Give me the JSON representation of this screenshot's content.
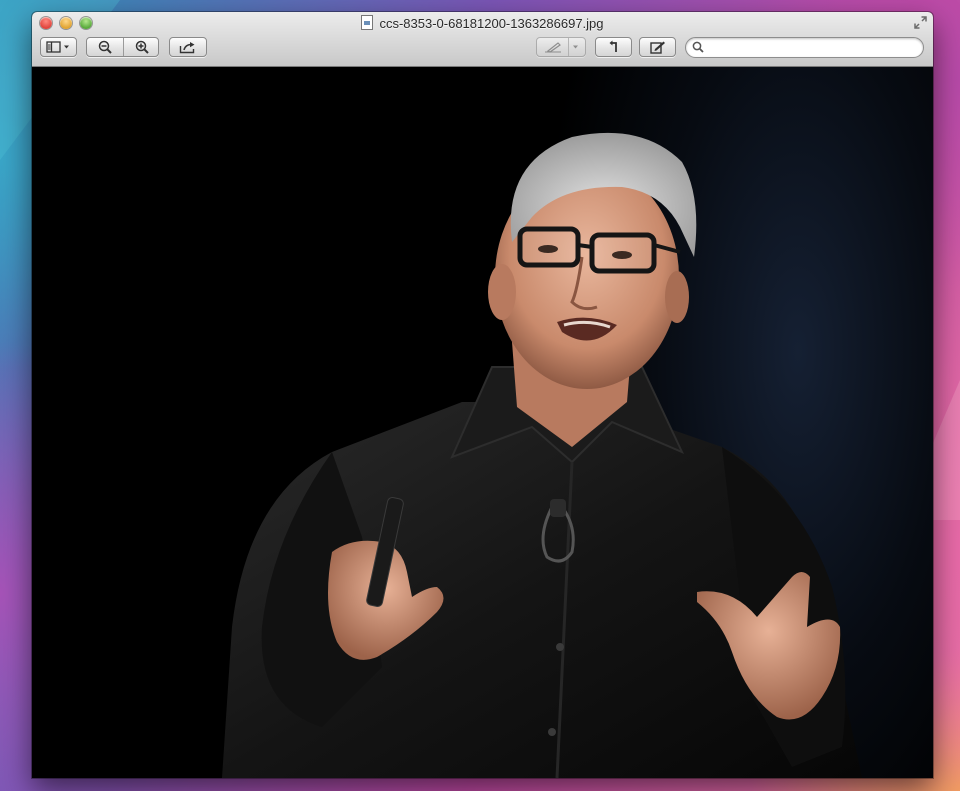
{
  "window": {
    "title": "ccs-8353-0-68181200-1363286697.jpg"
  },
  "toolbar": {
    "buttons": [
      {
        "name": "view-menu-button",
        "icon": "sidebar-icon"
      },
      {
        "name": "zoom-out-button",
        "icon": "zoom-out-icon"
      },
      {
        "name": "zoom-in-button",
        "icon": "zoom-in-icon"
      },
      {
        "name": "share-button",
        "icon": "share-icon"
      },
      {
        "name": "annotate-menu-button",
        "icon": "pen-icon"
      },
      {
        "name": "rotate-button",
        "icon": "rotate-icon"
      },
      {
        "name": "edit-toolbar-button",
        "icon": "edit-icon"
      }
    ],
    "search": {
      "placeholder": "",
      "value": ""
    }
  },
  "image": {
    "content": "photo-of-man-speaking-on-stage"
  },
  "colors": {
    "close": "#e0443c",
    "minimize": "#e0a330",
    "zoom": "#57a93a",
    "stage_background": "#000000",
    "shirt": "#121212"
  }
}
